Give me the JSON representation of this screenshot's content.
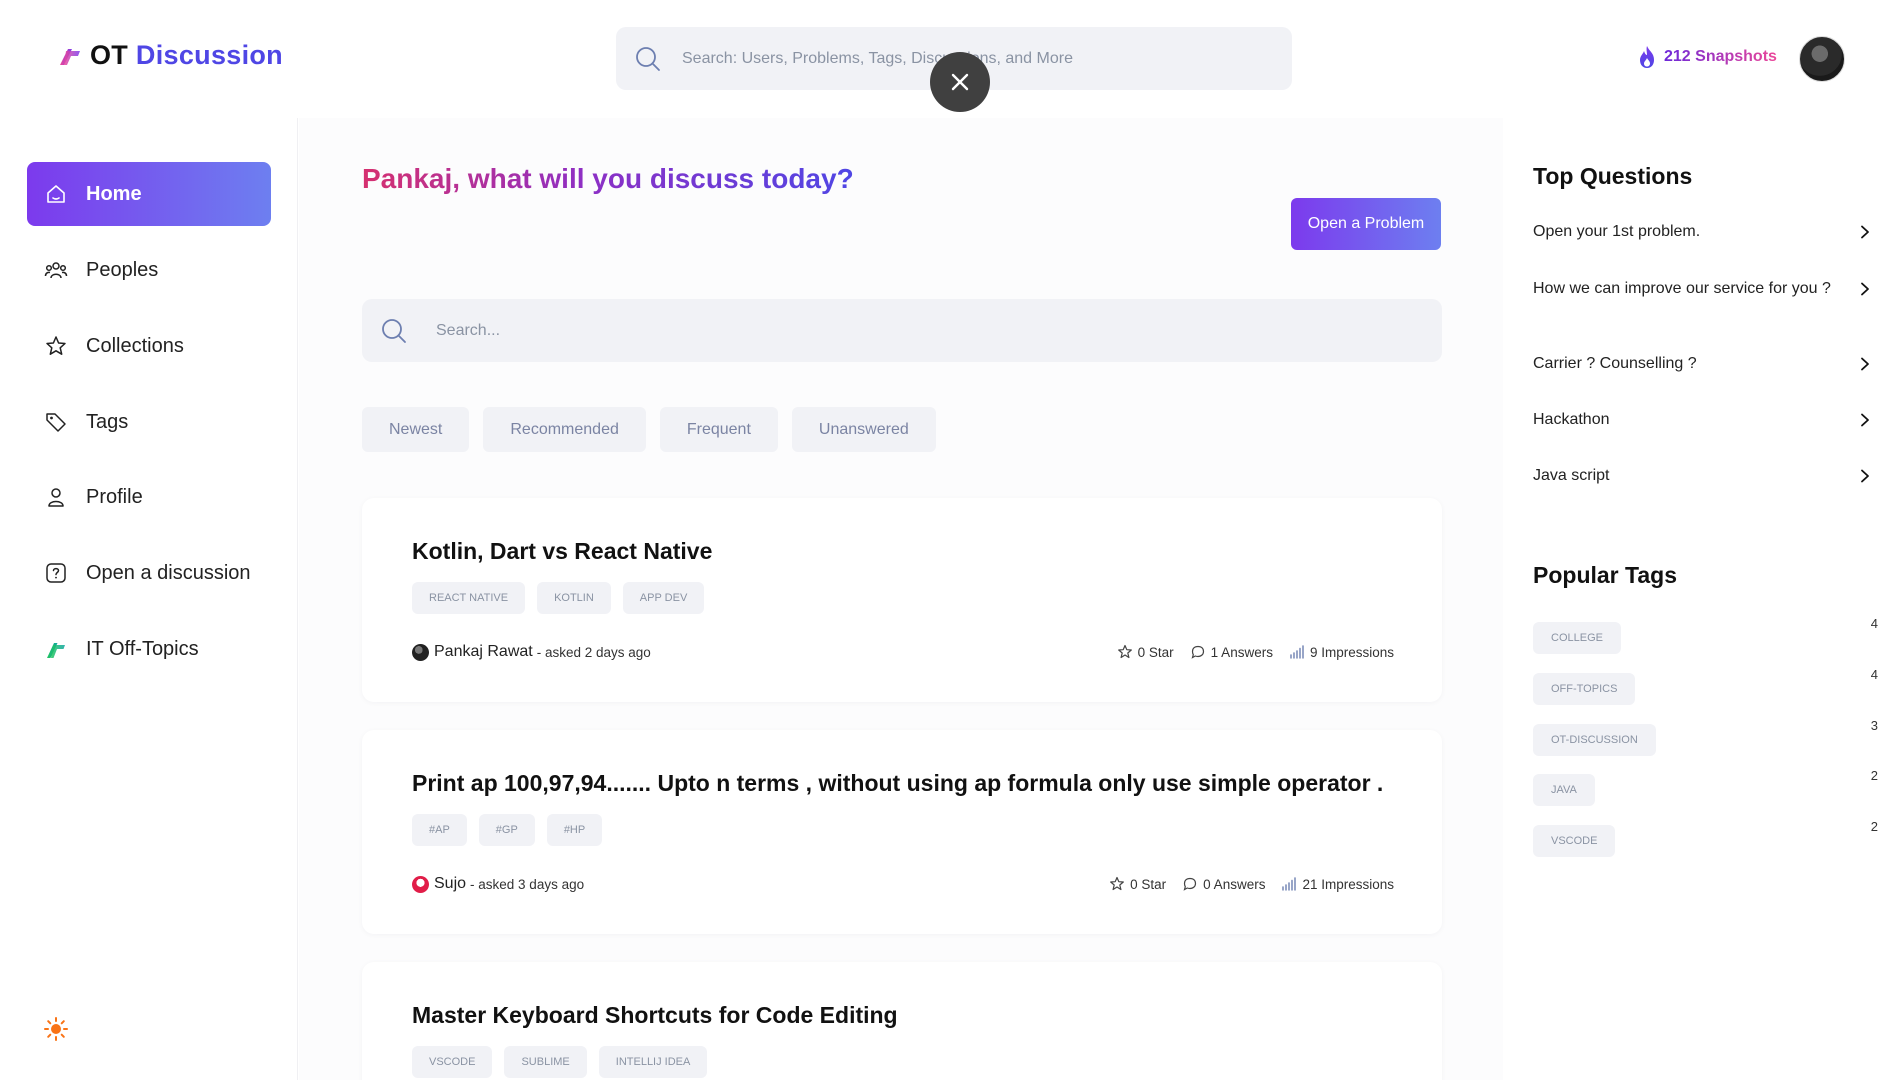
{
  "header": {
    "logo_part1": "OT",
    "logo_part2": "Discussion",
    "search_placeholder": "Search: Users, Problems, Tags, Discussions, and More",
    "snapshots_label": "212 Snapshots",
    "close_icon": "close-icon",
    "fire_icon": "fire-icon"
  },
  "sidebar": {
    "items": [
      {
        "label": "Home",
        "icon": "home-icon",
        "active": true
      },
      {
        "label": "Peoples",
        "icon": "people-icon"
      },
      {
        "label": "Collections",
        "icon": "star-icon"
      },
      {
        "label": "Tags",
        "icon": "tag-icon"
      },
      {
        "label": "Profile",
        "icon": "user-icon"
      },
      {
        "label": "Open a discussion",
        "icon": "question-icon"
      },
      {
        "label": "IT Off-Topics",
        "icon": "logo-icon"
      }
    ],
    "theme_icon": "sun-icon"
  },
  "main": {
    "greeting": "Pankaj, what will you discuss today?",
    "open_problem_label": "Open a Problem",
    "search_placeholder": "Search...",
    "filters": [
      "Newest",
      "Recommended",
      "Frequent",
      "Unanswered"
    ],
    "posts": [
      {
        "title": "Kotlin, Dart vs React Native",
        "tags": [
          "REACT NATIVE",
          "KOTLIN",
          "APP DEV"
        ],
        "author": "Pankaj Rawat",
        "meta": "- asked 2 days ago",
        "stars": "0 Star",
        "answers": "1 Answers",
        "impressions": "9 Impressions"
      },
      {
        "title": "Print ap 100,97,94....... Upto n terms , without using ap formula only use simple operator .",
        "tags": [
          "#AP",
          "#GP",
          "#HP"
        ],
        "author": "Sujo",
        "meta": "- asked 3 days ago",
        "stars": "0 Star",
        "answers": "0 Answers",
        "impressions": "21 Impressions"
      },
      {
        "title": "Master Keyboard Shortcuts for Code Editing",
        "tags": [
          "VSCODE",
          "SUBLIME",
          "INTELLIJ IDEA"
        ]
      }
    ]
  },
  "right": {
    "top_questions_title": "Top Questions",
    "top_questions": [
      "Open your 1st problem.",
      "How we can improve our service for you ?",
      "Carrier ? Counselling ?",
      "Hackathon",
      "Java script"
    ],
    "popular_tags_title": "Popular Tags",
    "popular_tags": [
      {
        "name": "COLLEGE",
        "count": "4"
      },
      {
        "name": "OFF-TOPICS",
        "count": "4"
      },
      {
        "name": "OT-DISCUSSION",
        "count": "3"
      },
      {
        "name": "JAVA",
        "count": "2"
      },
      {
        "name": "VSCODE",
        "count": "2"
      }
    ]
  },
  "colors": {
    "accent_start": "#7c3aed",
    "accent_end": "#6d7ff0",
    "brand_blue": "#4f46e5",
    "greeting_pink": "#d6306f"
  }
}
